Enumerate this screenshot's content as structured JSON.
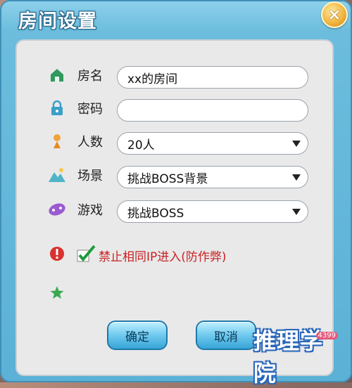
{
  "window": {
    "title": "房间设置",
    "close_label": "×"
  },
  "form": {
    "room_name": {
      "label": "房名",
      "value": "xx的房间"
    },
    "password": {
      "label": "密码",
      "value": ""
    },
    "players": {
      "label": "人数",
      "value": "20人"
    },
    "scene": {
      "label": "场景",
      "value": "挑战BOSS背景"
    },
    "game": {
      "label": "游戏",
      "value": "挑战BOSS"
    }
  },
  "anti_cheat": {
    "label": "禁止相同IP进入(防作弊)",
    "checked": true
  },
  "buttons": {
    "confirm": "确定",
    "cancel": "取消"
  },
  "logo": {
    "text": "推理学院",
    "badge": "4399"
  },
  "colors": {
    "frame": "#5bb1d6",
    "panel": "#e9e9ea",
    "warning_text": "#c92222",
    "button": "#6fc9ee"
  }
}
